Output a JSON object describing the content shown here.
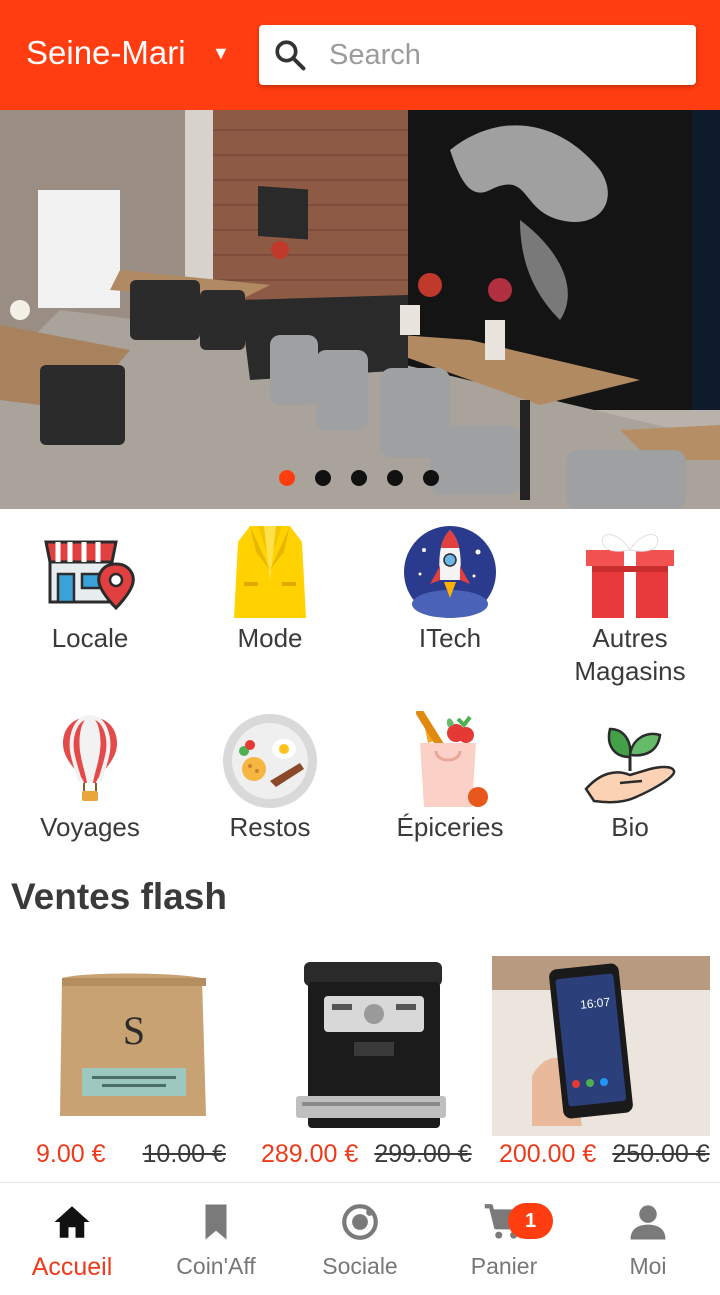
{
  "header": {
    "region": "Seine-Mari",
    "search_placeholder": "Search",
    "accent_color": "#ff3d10"
  },
  "banner": {
    "slide_count": 5,
    "active_slide": 1
  },
  "categories": [
    {
      "label": "Locale",
      "icon": "local-shop-icon"
    },
    {
      "label": "Mode",
      "icon": "suit-icon"
    },
    {
      "label": "ITech",
      "icon": "rocket-icon"
    },
    {
      "label": "Autres\nMagasins",
      "icon": "gift-icon"
    },
    {
      "label": "Voyages",
      "icon": "hot-air-balloon-icon"
    },
    {
      "label": "Restos",
      "icon": "plate-icon"
    },
    {
      "label": "Épiceries",
      "icon": "grocery-bag-icon"
    },
    {
      "label": "Bio",
      "icon": "plant-hand-icon"
    }
  ],
  "flash_sales": {
    "title": "Ventes flash",
    "products": [
      {
        "price": "9.00 €",
        "old_price": "10.00 €",
        "image": "coffee-bag"
      },
      {
        "price": "289.00 €",
        "old_price": "299.00 €",
        "image": "coffee-machine"
      },
      {
        "price": "200.00 €",
        "old_price": "250.00 €",
        "image": "smartphone"
      }
    ]
  },
  "bottom_nav": {
    "items": [
      {
        "label": "Accueil",
        "icon": "home-icon",
        "active": true
      },
      {
        "label": "Coin'Aff",
        "icon": "bookmark-icon"
      },
      {
        "label": "Sociale",
        "icon": "radio-target-icon"
      },
      {
        "label": "Panier",
        "icon": "cart-icon",
        "badge": "1"
      },
      {
        "label": "Moi",
        "icon": "person-icon"
      }
    ]
  }
}
